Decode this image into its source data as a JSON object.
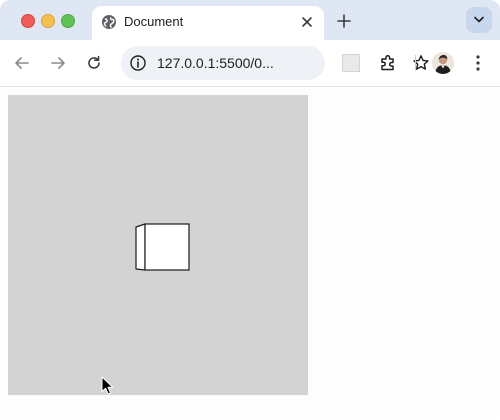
{
  "browser": {
    "tab": {
      "title": "Document",
      "icon": "globe-icon",
      "close_icon": "close-icon"
    },
    "new_tab_icon": "plus-icon",
    "tab_search_icon": "chevron-down-icon",
    "toolbar": {
      "back_icon": "back-arrow-icon",
      "forward_icon": "forward-arrow-icon",
      "reload_icon": "reload-icon",
      "address": {
        "site_info_icon": "info-icon",
        "url": "127.0.0.1:5500/0...",
        "bookmark_icon": "star-icon"
      },
      "extensions_icon": "puzzle-icon",
      "menu_icon": "more-vert-icon"
    }
  },
  "page": {
    "stage_color": "#d3d3d3",
    "shape": "cube",
    "cursor_icon": "arrow-cursor-icon"
  },
  "colors": {
    "tabstrip": "#dfe7f4",
    "close": "#ee5c54",
    "minimize": "#f4bf4f",
    "zoom": "#5fc454"
  }
}
